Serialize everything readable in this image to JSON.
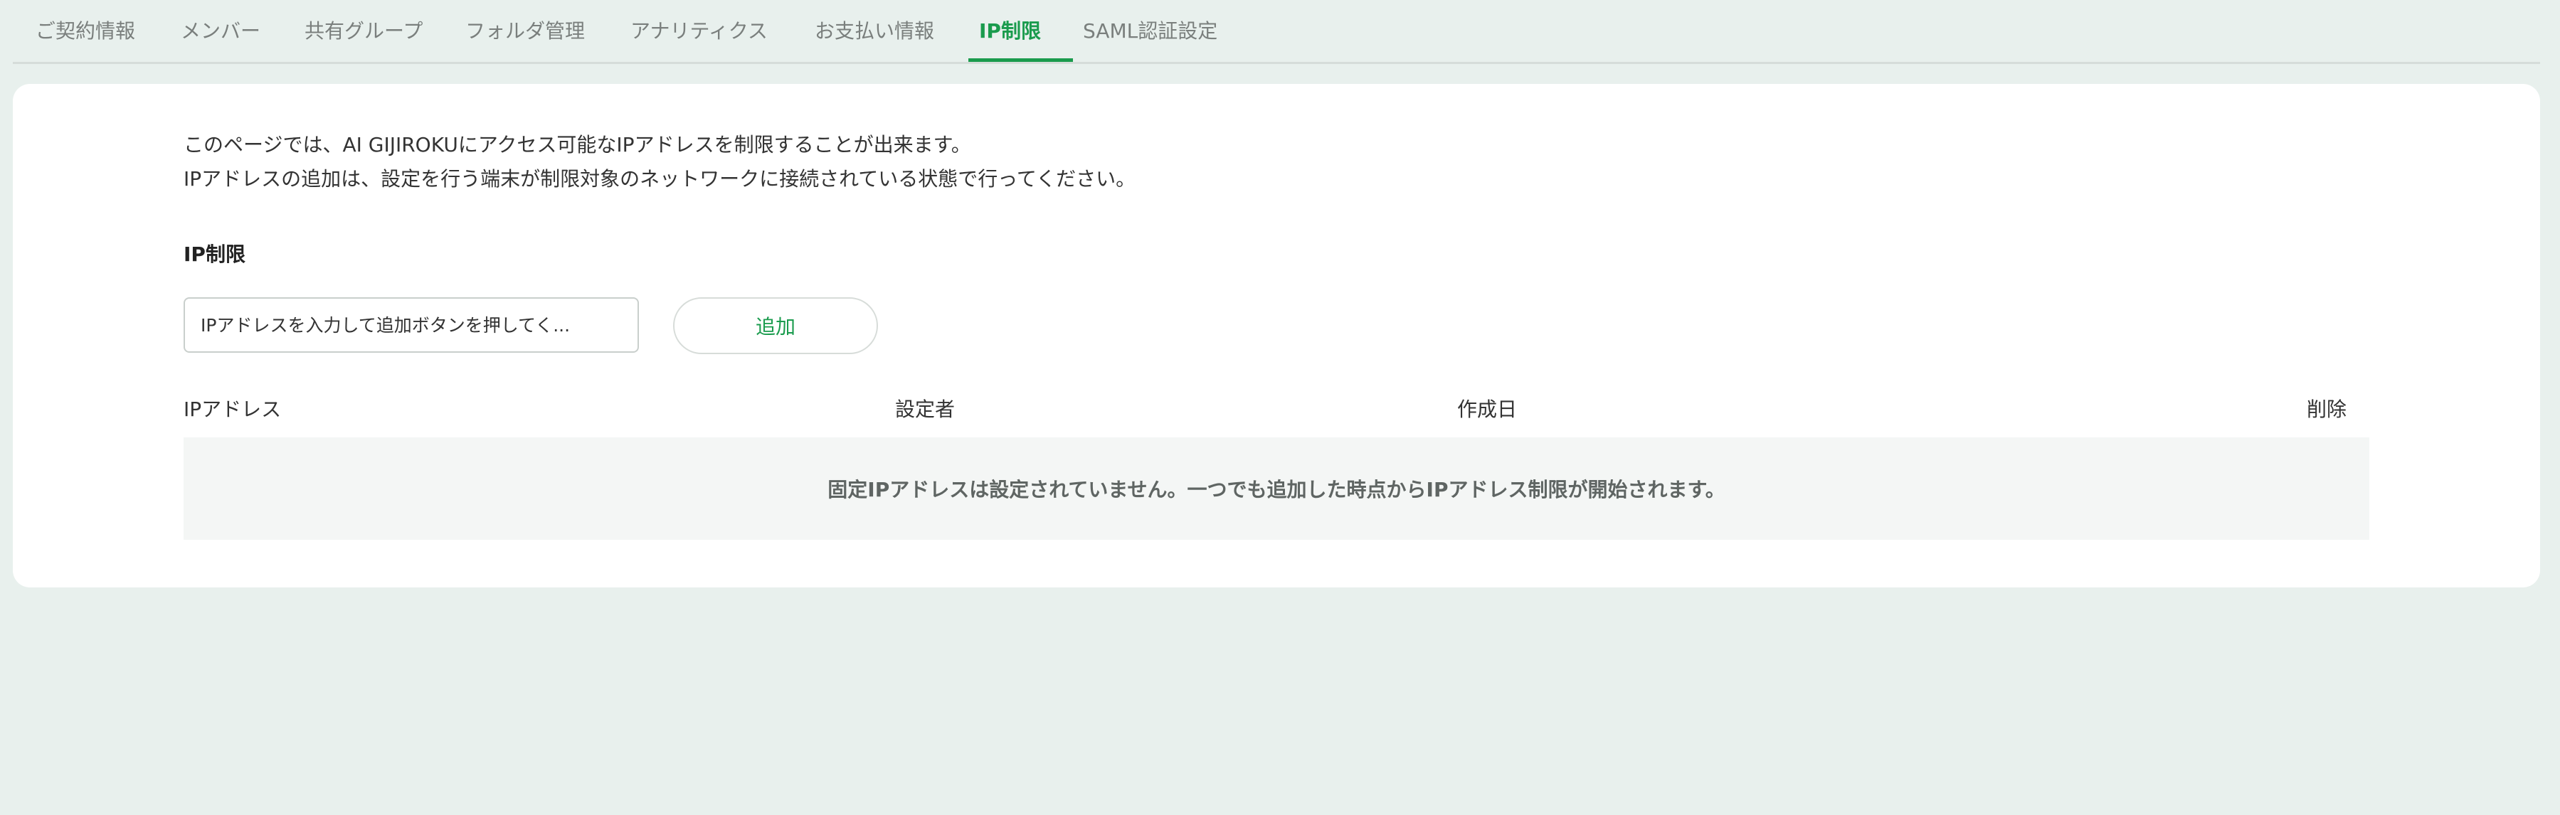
{
  "tabs": [
    {
      "label": "ご契約情報",
      "active": false
    },
    {
      "label": "メンバー",
      "active": false
    },
    {
      "label": "共有グループ",
      "active": false
    },
    {
      "label": "フォルダ管理",
      "active": false
    },
    {
      "label": "アナリティクス",
      "active": false
    },
    {
      "label": "お支払い情報",
      "active": false
    },
    {
      "label": "IP制限",
      "active": true
    },
    {
      "label": "SAML認証設定",
      "active": false
    }
  ],
  "main": {
    "description_line1": "このページでは、AI GIJIROKUにアクセス可能なIPアドレスを制限することが出来ます。",
    "description_line2": "IPアドレスの追加は、設定を行う端末が制限対象のネットワークに接続されている状態で行ってください。",
    "section_title": "IP制限",
    "ip_input": {
      "placeholder": "IPアドレスを入力して追加ボタンを押してく...",
      "value": ""
    },
    "add_button_label": "追加",
    "table": {
      "headers": {
        "ip": "IPアドレス",
        "setter": "設定者",
        "created": "作成日",
        "delete": "削除"
      },
      "rows": [],
      "empty_message": "固定IPアドレスは設定されていません。一つでも追加した時点からIPアドレス制限が開始されます。"
    }
  },
  "colors": {
    "accent": "#1a9b4d",
    "background": "#e8f0ed",
    "panel": "#ffffff",
    "empty_row": "#f4f6f5"
  }
}
